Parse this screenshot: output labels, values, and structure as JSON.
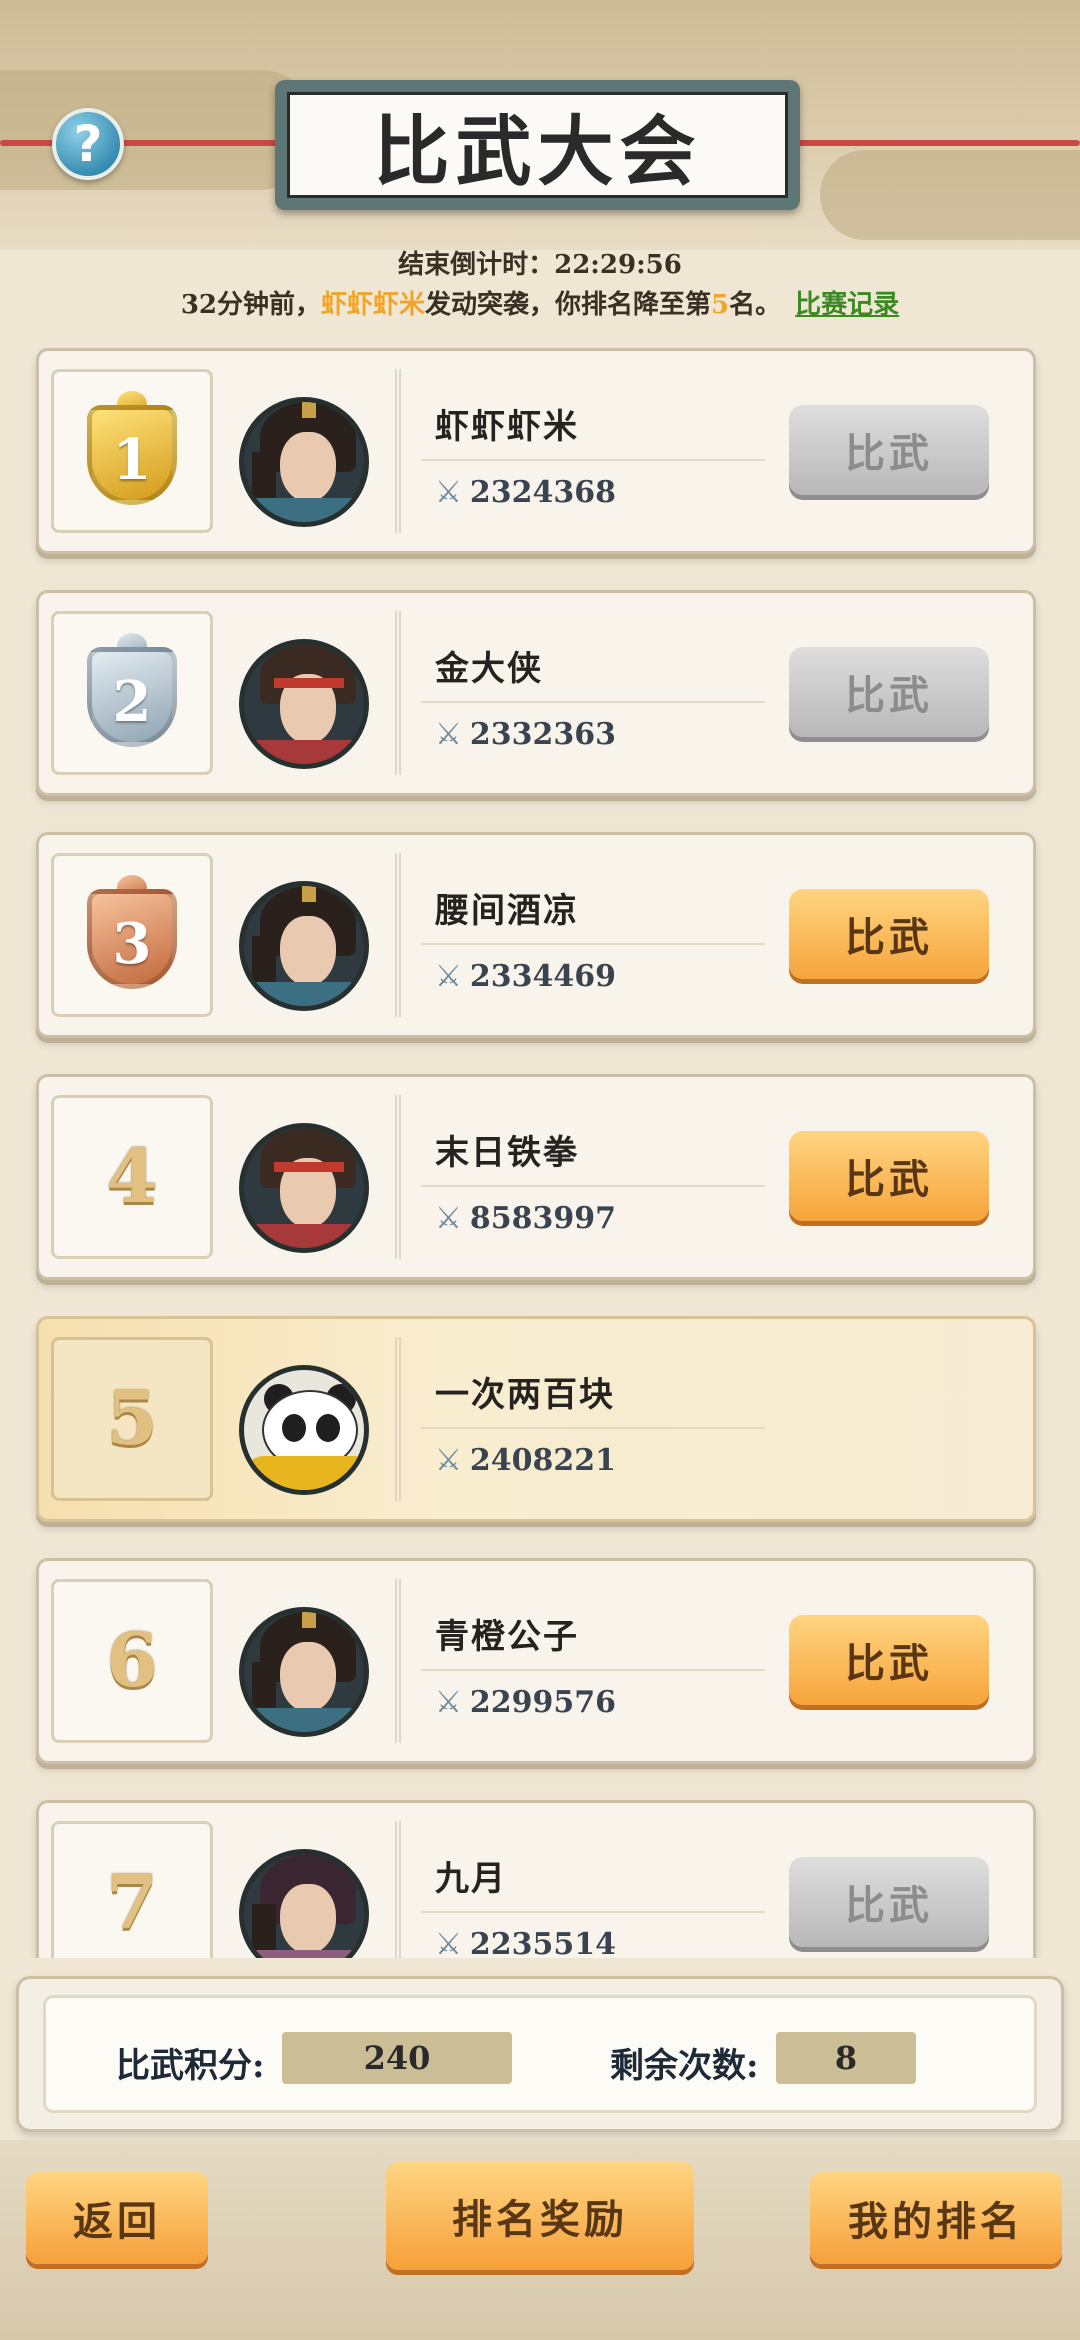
{
  "header": {
    "title": "比武大会",
    "help_icon": "question-mark-icon",
    "countdown_label": "结束倒计时：",
    "countdown_value": "22:29:56"
  },
  "notice": {
    "prefix": "32分钟前，",
    "attacker": "虾虾虾米",
    "middle": "发动突袭，你排名降至第",
    "rank": "5",
    "suffix": "名。",
    "record_link": "比赛记录"
  },
  "players": [
    {
      "rank": "1",
      "name": "虾虾虾米",
      "power": "2324368",
      "button": "比武",
      "button_state": "disabled",
      "medal": "gold",
      "avatar": "swordsman"
    },
    {
      "rank": "2",
      "name": "金大侠",
      "power": "2332363",
      "button": "比武",
      "button_state": "disabled",
      "medal": "silver",
      "avatar": "warrior"
    },
    {
      "rank": "3",
      "name": "腰间酒凉",
      "power": "2334469",
      "button": "比武",
      "button_state": "enabled",
      "medal": "bronze",
      "avatar": "swordsman"
    },
    {
      "rank": "4",
      "name": "末日铁拳",
      "power": "8583997",
      "button": "比武",
      "button_state": "enabled",
      "medal": "none",
      "avatar": "warrior"
    },
    {
      "rank": "5",
      "name": "一次两百块",
      "power": "2408221",
      "button": "",
      "button_state": "self",
      "medal": "none",
      "avatar": "panda"
    },
    {
      "rank": "6",
      "name": "青橙公子",
      "power": "2299576",
      "button": "比武",
      "button_state": "enabled",
      "medal": "none",
      "avatar": "swordsman"
    },
    {
      "rank": "7",
      "name": "九月",
      "power": "2235514",
      "button": "比武",
      "button_state": "disabled",
      "medal": "none",
      "avatar": "lady"
    }
  ],
  "stats": {
    "score_label": "比武积分:",
    "score_value": "240",
    "remaining_label": "剩余次数:",
    "remaining_value": "8"
  },
  "footer": {
    "back": "返回",
    "rank_reward": "排名奖励",
    "my_rank": "我的排名"
  },
  "colors": {
    "accent_orange": "#f7a43b",
    "disabled_grey": "#b8b8b8",
    "highlight_yellow": "#f0a428",
    "link_green": "#3b8a21"
  }
}
